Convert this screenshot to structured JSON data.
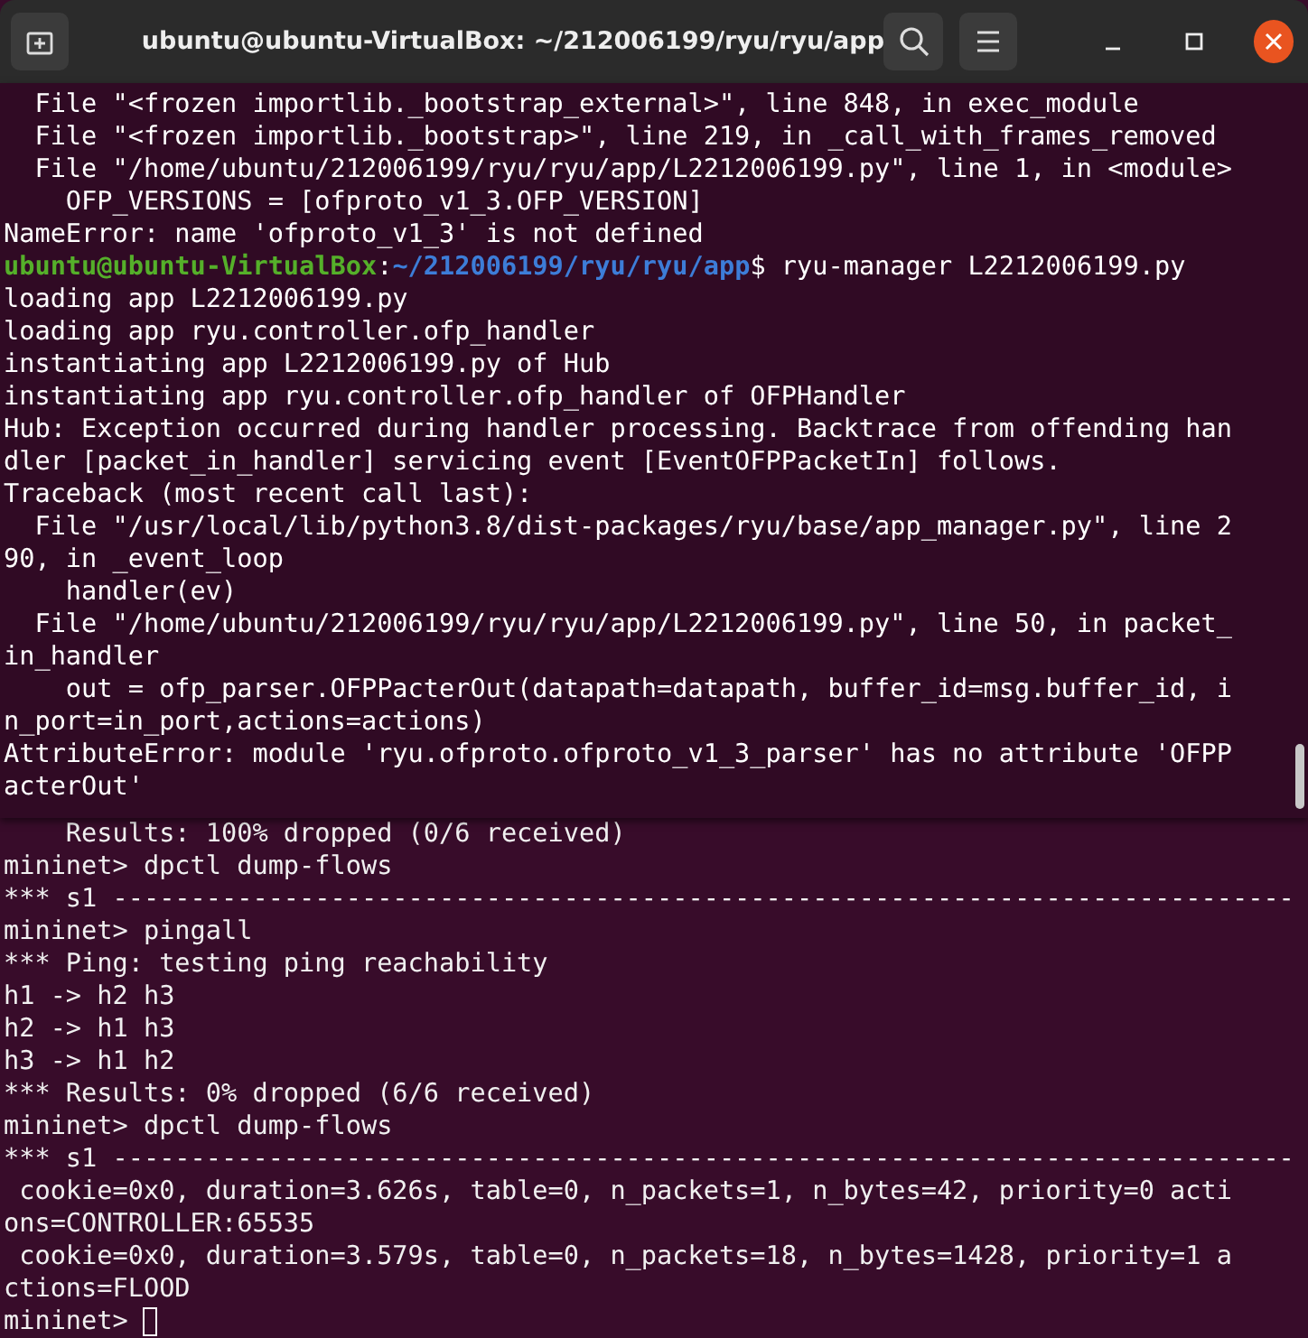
{
  "window": {
    "title": "ubuntu@ubuntu-VirtualBox: ~/212006199/ryu/ryu/app"
  },
  "front_terminal": {
    "lines": [
      {
        "kind": "text",
        "text": "  File \"<frozen importlib._bootstrap_external>\", line 848, in exec_module"
      },
      {
        "kind": "text",
        "text": "  File \"<frozen importlib._bootstrap>\", line 219, in _call_with_frames_removed"
      },
      {
        "kind": "text",
        "text": "  File \"/home/ubuntu/212006199/ryu/ryu/app/L2212006199.py\", line 1, in <module>"
      },
      {
        "kind": "text",
        "text": "    OFP_VERSIONS = [ofproto_v1_3.OFP_VERSION]"
      },
      {
        "kind": "text",
        "text": "NameError: name 'ofproto_v1_3' is not defined"
      },
      {
        "kind": "prompt",
        "user_host": "ubuntu@ubuntu-VirtualBox",
        "separator": ":",
        "path": "~/212006199/ryu/ryu/app",
        "symbol": "$",
        "command": " ryu-manager L2212006199.py"
      },
      {
        "kind": "text",
        "text": "loading app L2212006199.py"
      },
      {
        "kind": "text",
        "text": "loading app ryu.controller.ofp_handler"
      },
      {
        "kind": "text",
        "text": "instantiating app L2212006199.py of Hub"
      },
      {
        "kind": "text",
        "text": "instantiating app ryu.controller.ofp_handler of OFPHandler"
      },
      {
        "kind": "text",
        "text": "Hub: Exception occurred during handler processing. Backtrace from offending han"
      },
      {
        "kind": "text",
        "text": "dler [packet_in_handler] servicing event [EventOFPPacketIn] follows."
      },
      {
        "kind": "text",
        "text": "Traceback (most recent call last):"
      },
      {
        "kind": "text",
        "text": "  File \"/usr/local/lib/python3.8/dist-packages/ryu/base/app_manager.py\", line 2"
      },
      {
        "kind": "text",
        "text": "90, in _event_loop"
      },
      {
        "kind": "text",
        "text": "    handler(ev)"
      },
      {
        "kind": "text",
        "text": "  File \"/home/ubuntu/212006199/ryu/ryu/app/L2212006199.py\", line 50, in packet_"
      },
      {
        "kind": "text",
        "text": "in_handler"
      },
      {
        "kind": "text",
        "text": "    out = ofp_parser.OFPPacterOut(datapath=datapath, buffer_id=msg.buffer_id, i"
      },
      {
        "kind": "text",
        "text": "n_port=in_port,actions=actions)"
      },
      {
        "kind": "text",
        "text": "AttributeError: module 'ryu.ofproto.ofproto_v1_3_parser' has no attribute 'OFPP"
      },
      {
        "kind": "text",
        "text": "acterOut'"
      }
    ]
  },
  "back_terminal": {
    "cursor": true,
    "lines": [
      {
        "kind": "text",
        "text": "    Results: 100% dropped (0/6 received)"
      },
      {
        "kind": "text",
        "text": "mininet> dpctl dump-flows"
      },
      {
        "kind": "text",
        "text": "*** s1 ----------------------------------------------------------------------------"
      },
      {
        "kind": "text",
        "text": "mininet> pingall"
      },
      {
        "kind": "text",
        "text": "*** Ping: testing ping reachability"
      },
      {
        "kind": "text",
        "text": "h1 -> h2 h3"
      },
      {
        "kind": "text",
        "text": "h2 -> h1 h3"
      },
      {
        "kind": "text",
        "text": "h3 -> h1 h2"
      },
      {
        "kind": "text",
        "text": "*** Results: 0% dropped (6/6 received)"
      },
      {
        "kind": "text",
        "text": "mininet> dpctl dump-flows"
      },
      {
        "kind": "text",
        "text": "*** s1 ----------------------------------------------------------------------------"
      },
      {
        "kind": "text",
        "text": " cookie=0x0, duration=3.626s, table=0, n_packets=1, n_bytes=42, priority=0 acti"
      },
      {
        "kind": "text",
        "text": "ons=CONTROLLER:65535"
      },
      {
        "kind": "text",
        "text": " cookie=0x0, duration=3.579s, table=0, n_packets=18, n_bytes=1428, priority=1 a"
      },
      {
        "kind": "text",
        "text": "ctions=FLOOD"
      },
      {
        "kind": "text",
        "text": "mininet> "
      }
    ]
  }
}
